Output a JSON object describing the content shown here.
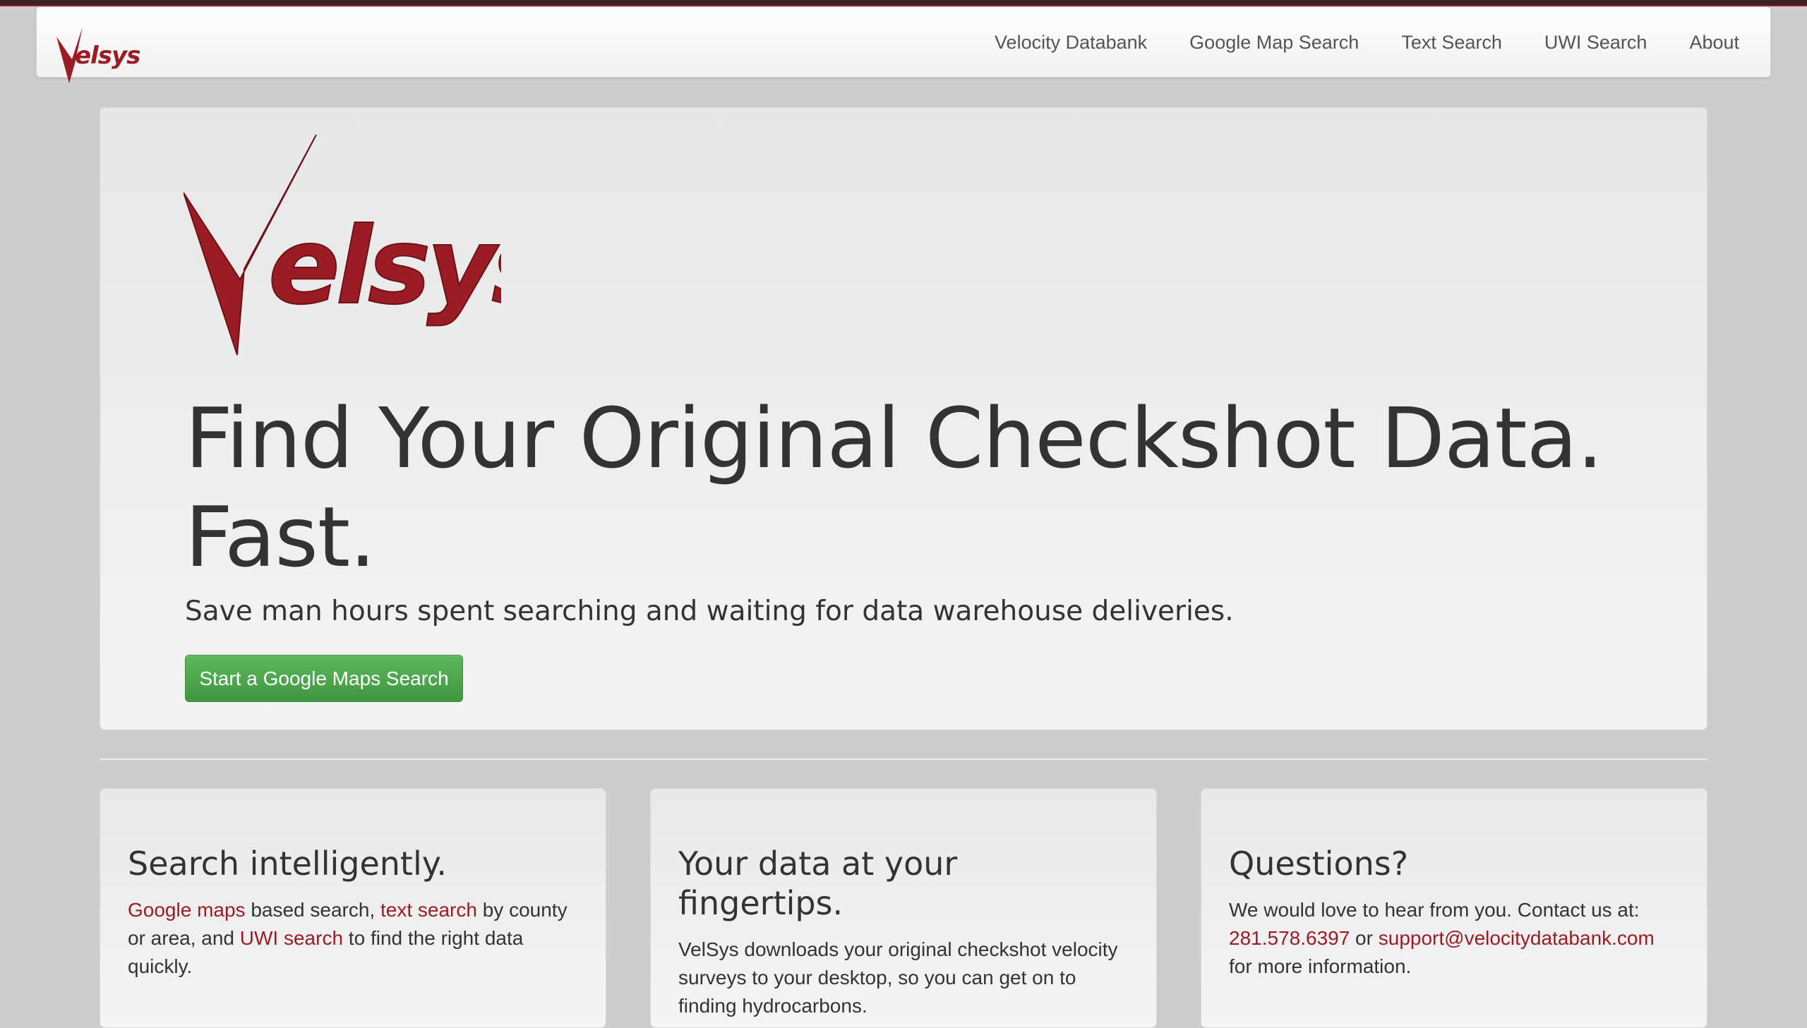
{
  "brand": {
    "logo_text": "Velsys",
    "logo_color": "#9b1c24"
  },
  "nav": {
    "items": [
      "Velocity Databank",
      "Google Map Search",
      "Text Search",
      "UWI Search",
      "About"
    ]
  },
  "hero": {
    "title": "Find Your Original Checkshot Data. Fast.",
    "subtitle": "Save man hours spent searching and waiting for data warehouse deliveries.",
    "cta_label": "Start a Google Maps Search",
    "cta_color": "#5cb85c"
  },
  "cards": [
    {
      "title": "Search intelligently.",
      "link1": "Google maps",
      "text1": " based search, ",
      "link2": "text search",
      "text2": " by county or area, and ",
      "link3": "UWI search",
      "text3": " to find the right data quickly."
    },
    {
      "title": "Your data at your fingertips.",
      "body": "VelSys downloads your original checkshot velocity surveys to your desktop, so you can get on to finding hydrocarbons."
    },
    {
      "title": "Questions?",
      "text1": "We would love to hear from you. Contact us at: ",
      "phone": "281.578.6397",
      "text2": " or ",
      "email": "support@velocitydatabank.com",
      "text3": " for more information."
    }
  ],
  "link_color": "#9b1c24"
}
